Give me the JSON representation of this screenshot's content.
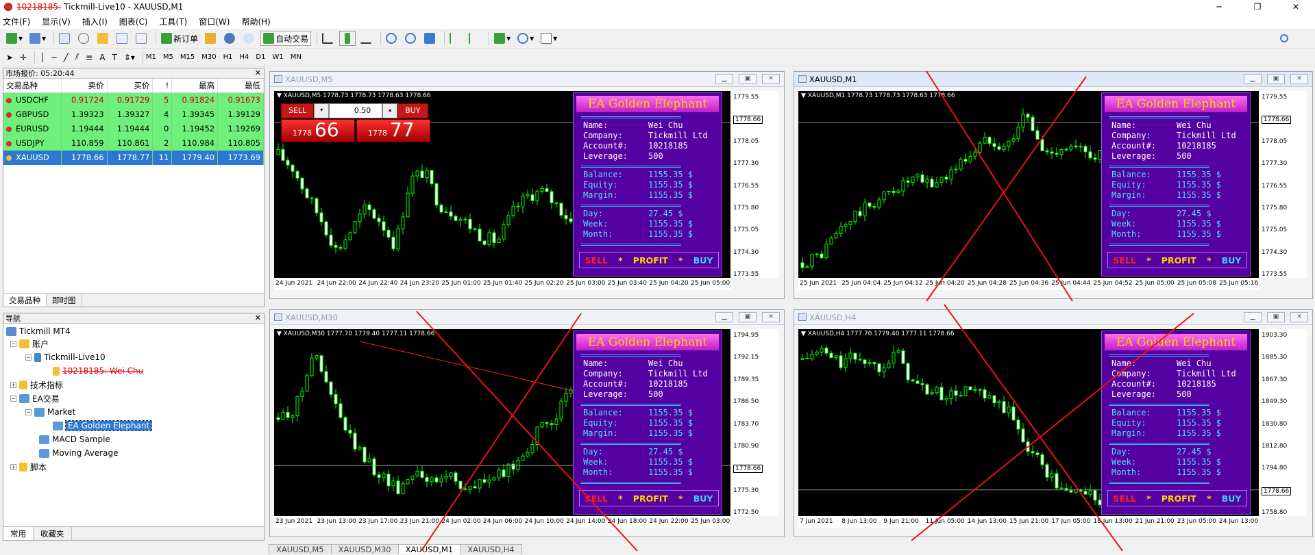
{
  "titlebar": {
    "account": "10218185:",
    "title": "Tickmill-Live10 - XAUUSD,M1"
  },
  "menus": [
    "文件(F)",
    "显示(V)",
    "插入(I)",
    "图表(C)",
    "工具(T)",
    "窗口(W)",
    "帮助(H)"
  ],
  "toolbar": {
    "new_order": "新订单",
    "auto_trade": "自动交易"
  },
  "timeframes": [
    "M1",
    "M5",
    "M15",
    "M30",
    "H1",
    "H4",
    "D1",
    "W1",
    "MN"
  ],
  "market_watch": {
    "header": "市场报价: 05:20:44",
    "columns": [
      "交易品种",
      "卖价",
      "买价",
      "!",
      "最高",
      "最低"
    ],
    "rows": [
      {
        "symbol": "USDCHF",
        "bid": "0.91724",
        "ask": "0.91729",
        "spread": "5",
        "high": "0.91824",
        "low": "0.91673"
      },
      {
        "symbol": "GBPUSD",
        "bid": "1.39323",
        "ask": "1.39327",
        "spread": "4",
        "high": "1.39345",
        "low": "1.39129"
      },
      {
        "symbol": "EURUSD",
        "bid": "1.19444",
        "ask": "1.19444",
        "spread": "0",
        "high": "1.19452",
        "low": "1.19269"
      },
      {
        "symbol": "USDJPY",
        "bid": "110.859",
        "ask": "110.861",
        "spread": "2",
        "high": "110.984",
        "low": "110.805"
      },
      {
        "symbol": "XAUUSD",
        "bid": "1778.66",
        "ask": "1778.77",
        "spread": "11",
        "high": "1779.40",
        "low": "1773.69"
      }
    ],
    "tabs": [
      "交易品种",
      "即时图"
    ]
  },
  "navigator": {
    "header": "导航",
    "root": "Tickmill MT4",
    "accounts": "账户",
    "server": "Tickmill-Live10",
    "account_entry": "10218185: Wei Chu",
    "indicators": "技术指标",
    "ea": "EA交易",
    "market": "Market",
    "ea_selected": "EA Golden Elephant",
    "macd": "MACD Sample",
    "ma": "Moving Average",
    "scripts": "脚本",
    "tabs": [
      "常用",
      "收藏夹"
    ]
  },
  "trade_panel": {
    "sell": "SELL",
    "buy": "BUY",
    "volume": "0.50",
    "bid_small": "1778",
    "bid_big": "66",
    "ask_small": "1778",
    "ask_big": "77"
  },
  "ea_panel": {
    "title": "EA Golden Elephant",
    "name_k": "Name:",
    "name_v": "Wei Chu",
    "company_k": "Company:",
    "company_v": "Tickmill Ltd",
    "account_k": "Account#:",
    "account_v": "10218185",
    "leverage_k": "Leverage:",
    "leverage_v": "500",
    "balance_k": "Balance:",
    "balance_v": "1155.35 $",
    "equity_k": "Equity:",
    "equity_v": "1155.35 $",
    "margin_k": "Margin:",
    "margin_v": "1155.35 $",
    "day_k": "Day:",
    "day_v": "27.45 $",
    "week_k": "Week:",
    "week_v": "1155.35 $",
    "month_k": "Month:",
    "month_v": "1155.35 $",
    "sell": "SELL",
    "profit": "PROFIT",
    "buy": "BUY",
    "star": "*",
    "sep": "=========================="
  },
  "charts": [
    {
      "id": "m5",
      "title": "XAUUSD,M5",
      "label": "XAUUSD,M5  1778.73 1778.73 1778.63 1778.66",
      "yticks": [
        "1779.55",
        "1778.66",
        "1778.05",
        "1777.30",
        "1776.55",
        "1775.80",
        "1775.05",
        "1774.30",
        "1773.55"
      ],
      "xticks": [
        "24 Jun 2021",
        "24 Jun 22:00",
        "24 Jun 22:40",
        "24 Jun 23:20",
        "25 Jun 01:00",
        "25 Jun 01:40",
        "25 Jun 02:20",
        "25 Jun 03:00",
        "25 Jun 03:40",
        "25 Jun 04:20",
        "25 Jun 05:00"
      ],
      "price_tag": "1778.66"
    },
    {
      "id": "m1",
      "title": "XAUUSD,M1",
      "label": "XAUUSD,M1  1778.73 1778.73 1778.63 1778.66",
      "yticks": [
        "1779.55",
        "1778.66",
        "1778.05",
        "1777.30",
        "1776.55",
        "1775.80",
        "1775.05",
        "1774.30",
        "1773.55"
      ],
      "xticks": [
        "25 Jun 2021",
        "25 Jun 04:04",
        "25 Jun 04:12",
        "25 Jun 04:20",
        "25 Jun 04:28",
        "25 Jun 04:36",
        "25 Jun 04:44",
        "25 Jun 04:52",
        "25 Jun 05:00",
        "25 Jun 05:08",
        "25 Jun 05:16"
      ],
      "price_tag": "1778.66"
    },
    {
      "id": "m30",
      "title": "XAUUSD,M30",
      "label": "XAUUSD,M30  1777.70 1779.40 1777.11 1778.66",
      "yticks": [
        "1794.95",
        "1792.15",
        "1789.35",
        "1786.50",
        "1783.70",
        "1780.90",
        "1778.66",
        "1775.30",
        "1772.50"
      ],
      "xticks": [
        "23 Jun 2021",
        "23 Jun 13:00",
        "23 Jun 17:00",
        "23 Jun 21:00",
        "24 Jun 02:00",
        "24 Jun 06:00",
        "24 Jun 10:00",
        "24 Jun 14:00",
        "24 Jun 18:00",
        "24 Jun 22:00",
        "25 Jun 03:00"
      ],
      "price_tag": "1778.66"
    },
    {
      "id": "h4",
      "title": "XAUUSD,H4",
      "label": "XAUUSD,H4  1777.70 1779.40 1777.11 1778.66",
      "yticks": [
        "1903.30",
        "1885.30",
        "1867.30",
        "1849.30",
        "1830.80",
        "1812.80",
        "1794.80",
        "1778.66",
        "1758.80"
      ],
      "xticks": [
        "7 Jun 2021",
        "8 Jun 13:00",
        "9 Jun 21:00",
        "11 Jun 05:00",
        "14 Jun 13:00",
        "15 Jun 21:00",
        "17 Jun 05:00",
        "18 Jun 13:00",
        "21 Jun 21:00",
        "23 Jun 05:00",
        "24 Jun 13:00"
      ],
      "price_tag": "1778.66"
    }
  ],
  "chart_tabs": [
    "XAUUSD,M5",
    "XAUUSD,M30",
    "XAUUSD,M1",
    "XAUUSD,H4"
  ],
  "colors": {
    "bull": "#00ff00",
    "bear": "#ffffff",
    "mw_green": "#6ff07a",
    "select_blue": "#2b78d4",
    "ea_purple": "#5500a0"
  },
  "icons": [
    "file-icon",
    "new-chart-icon",
    "crosshair-icon",
    "zoom-in-icon",
    "zoom-out-icon",
    "clock-icon",
    "search-icon"
  ]
}
